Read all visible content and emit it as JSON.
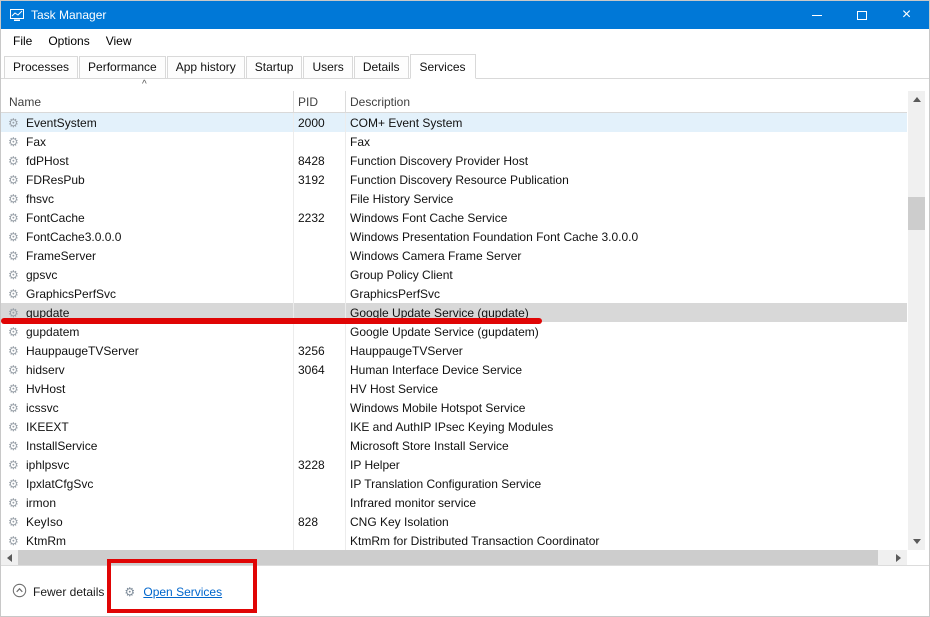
{
  "window": {
    "title": "Task Manager"
  },
  "icons": {
    "app": "task-manager-icon",
    "close_glyph": "×",
    "gear_glyph": "⚙",
    "sort_caret_glyph": "^"
  },
  "menu": {
    "items": [
      "File",
      "Options",
      "View"
    ]
  },
  "tabs": {
    "active": "Services",
    "items": [
      {
        "label": "Processes"
      },
      {
        "label": "Performance"
      },
      {
        "label": "App history"
      },
      {
        "label": "Startup"
      },
      {
        "label": "Users"
      },
      {
        "label": "Details"
      },
      {
        "label": "Services",
        "state": "active"
      }
    ]
  },
  "table": {
    "columns": [
      "Name",
      "PID",
      "Description"
    ],
    "rows": [
      {
        "name": "EventSystem",
        "pid": "2000",
        "description": "COM+ Event System",
        "state": "highlight"
      },
      {
        "name": "Fax",
        "pid": "",
        "description": "Fax"
      },
      {
        "name": "fdPHost",
        "pid": "8428",
        "description": "Function Discovery Provider Host"
      },
      {
        "name": "FDResPub",
        "pid": "3192",
        "description": "Function Discovery Resource Publication"
      },
      {
        "name": "fhsvc",
        "pid": "",
        "description": "File History Service"
      },
      {
        "name": "FontCache",
        "pid": "2232",
        "description": "Windows Font Cache Service"
      },
      {
        "name": "FontCache3.0.0.0",
        "pid": "",
        "description": "Windows Presentation Foundation Font Cache 3.0.0.0"
      },
      {
        "name": "FrameServer",
        "pid": "",
        "description": "Windows Camera Frame Server"
      },
      {
        "name": "gpsvc",
        "pid": "",
        "description": "Group Policy Client"
      },
      {
        "name": "GraphicsPerfSvc",
        "pid": "",
        "description": "GraphicsPerfSvc"
      },
      {
        "name": "gupdate",
        "pid": "",
        "description": "Google Update Service (gupdate)",
        "state": "selected"
      },
      {
        "name": "gupdatem",
        "pid": "",
        "description": "Google Update Service (gupdatem)"
      },
      {
        "name": "HauppaugeTVServer",
        "pid": "3256",
        "description": "HauppaugeTVServer"
      },
      {
        "name": "hidserv",
        "pid": "3064",
        "description": "Human Interface Device Service"
      },
      {
        "name": "HvHost",
        "pid": "",
        "description": "HV Host Service"
      },
      {
        "name": "icssvc",
        "pid": "",
        "description": "Windows Mobile Hotspot Service"
      },
      {
        "name": "IKEEXT",
        "pid": "",
        "description": "IKE and AuthIP IPsec Keying Modules"
      },
      {
        "name": "InstallService",
        "pid": "",
        "description": "Microsoft Store Install Service"
      },
      {
        "name": "iphlpsvc",
        "pid": "3228",
        "description": "IP Helper"
      },
      {
        "name": "IpxlatCfgSvc",
        "pid": "",
        "description": "IP Translation Configuration Service"
      },
      {
        "name": "irmon",
        "pid": "",
        "description": "Infrared monitor service"
      },
      {
        "name": "KeyIso",
        "pid": "828",
        "description": "CNG Key Isolation"
      },
      {
        "name": "KtmRm",
        "pid": "",
        "description": "KtmRm for Distributed Transaction Coordinator"
      }
    ]
  },
  "footer": {
    "fewer_details": "Fewer details",
    "open_services": "Open Services"
  },
  "colors": {
    "titlebar": "#0078D7",
    "highlight_row": "#e3f1fb",
    "selected_row": "#d8d8d8",
    "annotation_red": "#e00505",
    "link": "#0066cc"
  }
}
